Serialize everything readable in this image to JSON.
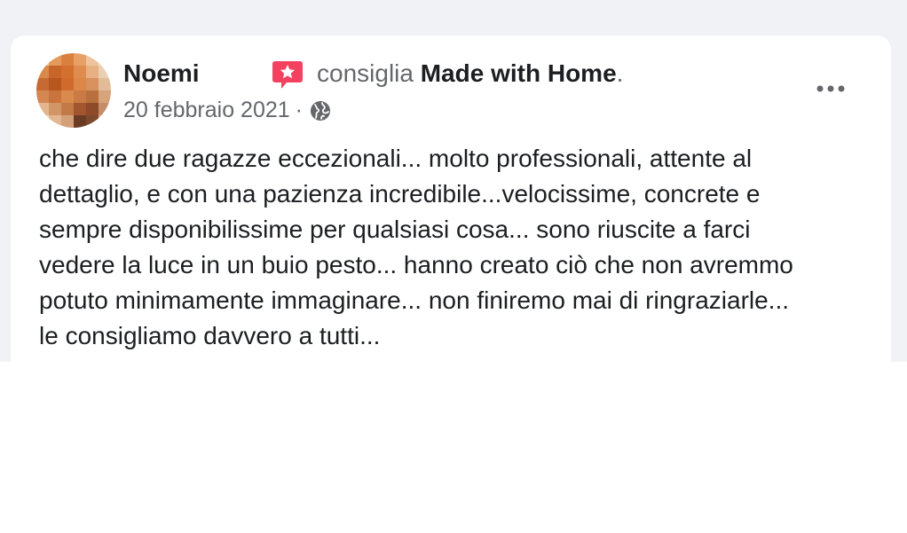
{
  "post": {
    "author": "Noemi",
    "recommend_verb": "consiglia",
    "page_name": "Made with Home",
    "page_suffix": ".",
    "date": "20 febbraio 2021",
    "separator": "·",
    "privacy_icon": "globe-icon",
    "recommend_icon": "star-speech-bubble-icon",
    "more_icon": "more-options-icon",
    "text_lines": [
      "che dire due ragazze eccezionali... molto professionali, attente al",
      "dettaglio, e con una pazienza incredibile...velocissime, concrete e",
      "sempre disponibilissime per qualsiasi cosa... sono riuscite a farci",
      "vedere la luce in un buio pesto... hanno creato ciò che non avremmo",
      "potuto minimamente immaginare... non finiremo mai di ringraziarle...",
      "le consigliamo davvero a tutti..."
    ]
  },
  "colors": {
    "background": "#f0f2f5",
    "card": "#ffffff",
    "primary_text": "#1c1e21",
    "secondary_text": "#65676b",
    "recommend_accent": "#f3425f"
  }
}
